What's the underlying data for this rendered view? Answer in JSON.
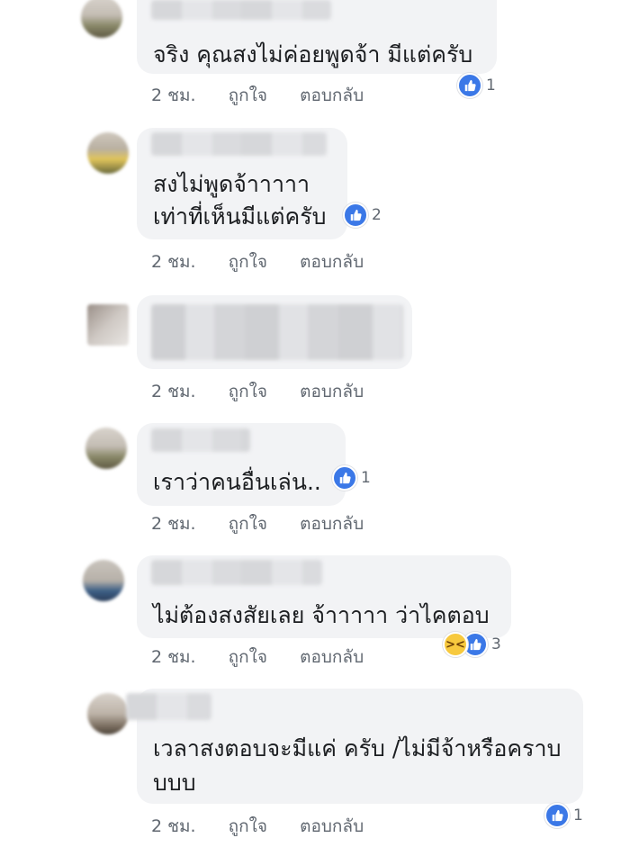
{
  "comments": [
    {
      "text": "จริง คุณสงไม่ค่อยพูดจ้า มีแต่ครับ",
      "time": "2 ชม.",
      "like_label": "ถูกใจ",
      "reply_label": "ตอบกลับ",
      "reactions": [
        "like"
      ],
      "reaction_count": "1"
    },
    {
      "text_lines": [
        "สงไม่พูดจ้าาาาา",
        "เท่าที่เห็นมีแต่ครับ"
      ],
      "time": "2 ชม.",
      "like_label": "ถูกใจ",
      "reply_label": "ตอบกลับ",
      "reactions": [
        "like"
      ],
      "reaction_count": "2"
    },
    {
      "text": "",
      "time": "2 ชม.",
      "like_label": "ถูกใจ",
      "reply_label": "ตอบกลับ",
      "reactions": [],
      "reaction_count": ""
    },
    {
      "text": "เราว่าคนอื่นเล่น..",
      "time": "2 ชม.",
      "like_label": "ถูกใจ",
      "reply_label": "ตอบกลับ",
      "reactions": [
        "like"
      ],
      "reaction_count": "1"
    },
    {
      "text": "ไม่ต้องสงสัยเลย จ้าาาาา ว่าไคตอบ",
      "time": "2 ชม.",
      "like_label": "ถูกใจ",
      "reply_label": "ตอบกลับ",
      "reactions": [
        "haha",
        "like"
      ],
      "reaction_count": "3"
    },
    {
      "text_lines": [
        "เวลาสงตอบจะมีแค่ ครับ /ไม่มีจ้าหรือคราบ",
        "บบบ"
      ],
      "time": "2 ชม.",
      "like_label": "ถูกใจ",
      "reply_label": "ตอบกลับ",
      "reactions": [
        "like"
      ],
      "reaction_count": "1"
    }
  ],
  "colors": {
    "bubble": "#f2f3f5",
    "like": "#3b78e7",
    "meta_text": "#606770"
  },
  "icons": {
    "like": "thumbs-up-icon",
    "haha": "laughing-face-icon"
  }
}
